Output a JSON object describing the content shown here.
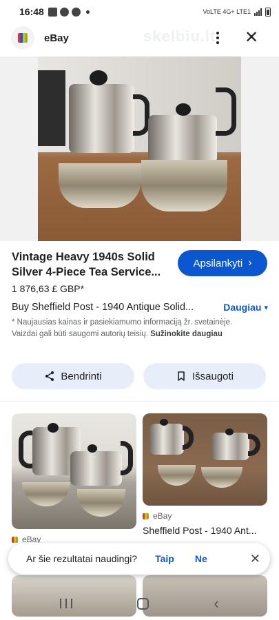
{
  "status_bar": {
    "time": "16:48",
    "network": "VoLTE 4G+ LTE1"
  },
  "header": {
    "site_name": "eBay",
    "watermark": "skelbiu.lt"
  },
  "product": {
    "title": "Vintage Heavy 1940s Solid Silver 4-Piece Tea Service...",
    "price": "1 876,63 £ GBP*",
    "source": "Buy Sheffield Post - 1940 Antique Solid...",
    "more_label": "Daugiau",
    "visit_label": "Apsilankyti",
    "disclaimer": "* Naujausias kainas ir pasiekiamumo informaciją žr. svetainėje. Vaizdai gali būti saugomi autorių teisių.",
    "learn_more": "Sužinokite daugiau"
  },
  "actions": {
    "share_label": "Bendrinti",
    "save_label": "Išsaugoti"
  },
  "results": [
    {
      "source": "eBay",
      "title": ""
    },
    {
      "source": "eBay",
      "title": "Sheffield Post - 1940 Ant..."
    }
  ],
  "feedback": {
    "question": "Ar šie rezultatai naudingi?",
    "yes": "Taip",
    "no": "Ne"
  },
  "colors": {
    "accent": "#0b57d0",
    "chip_bg": "#e8eef9"
  }
}
